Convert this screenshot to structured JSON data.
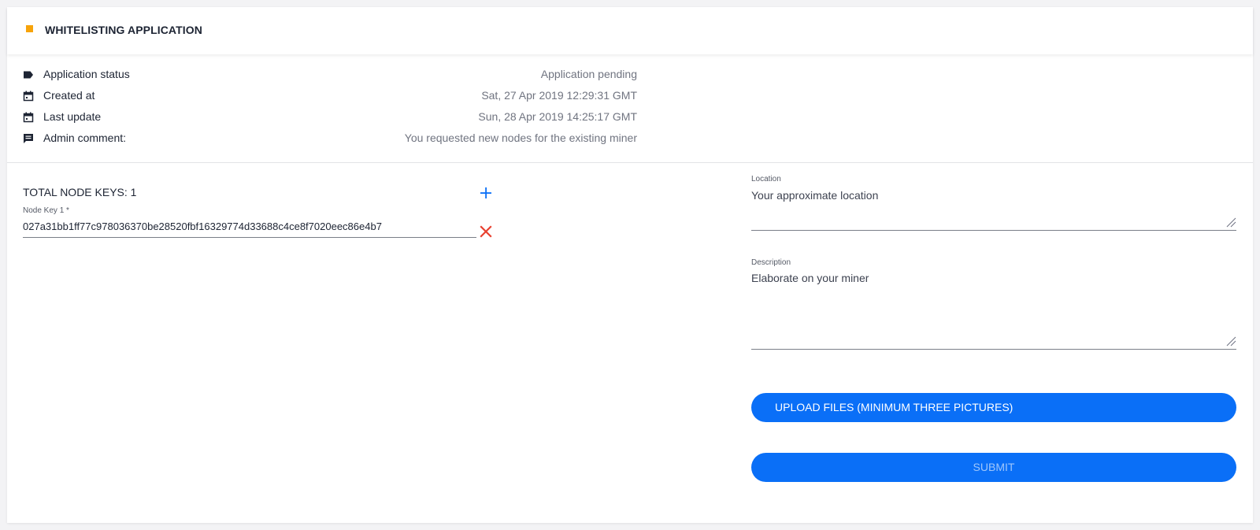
{
  "header": {
    "title": "WHITELISTING APPLICATION",
    "accent_color": "#f7a30a"
  },
  "info": {
    "status": {
      "icon": "tag-icon",
      "label": "Application status",
      "value": "Application pending"
    },
    "created": {
      "icon": "calendar-icon",
      "label": "Created at",
      "value": "Sat, 27 Apr 2019 12:29:31 GMT"
    },
    "updated": {
      "icon": "calendar-icon",
      "label": "Last update",
      "value": "Sun, 28 Apr 2019 14:25:17 GMT"
    },
    "comment": {
      "icon": "comment-icon",
      "label": "Admin comment:",
      "value": "You requested new nodes for the existing miner"
    }
  },
  "node_keys": {
    "total_label": "TOTAL NODE KEYS: 1",
    "add_icon": "plus-icon",
    "remove_icon": "close-icon",
    "items": [
      {
        "label": "Node Key 1 *",
        "value": "027a31bb1ff77c978036370be28520fbf16329774d33688c4ce8f7020eec86e4b7"
      }
    ]
  },
  "form": {
    "location": {
      "label": "Location",
      "placeholder": "Your approximate location"
    },
    "description": {
      "label": "Description",
      "placeholder": "Elaborate on your miner"
    },
    "upload_label": "UPLOAD FILES (MINIMUM THREE PICTURES)",
    "submit_label": "SUBMIT"
  },
  "colors": {
    "primary": "#0a6ff7",
    "danger": "#e8402f",
    "muted_text": "#707480"
  }
}
